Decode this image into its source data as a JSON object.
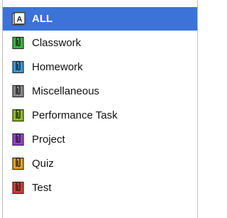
{
  "categories": [
    {
      "label": "ALL",
      "icon": "all-letter-a-icon",
      "color": "#ffffff",
      "selected": true
    },
    {
      "label": "Classwork",
      "icon": "green-clip-icon",
      "color": "#36b83a"
    },
    {
      "label": "Homework",
      "icon": "blue-clip-icon",
      "color": "#2f9be0"
    },
    {
      "label": "Miscellaneous",
      "icon": "gray-clip-icon",
      "color": "#8a8a8a"
    },
    {
      "label": "Performance Task",
      "icon": "lime-clip-icon",
      "color": "#8ec11c"
    },
    {
      "label": "Project",
      "icon": "purple-clip-icon",
      "color": "#9a3fd0"
    },
    {
      "label": "Quiz",
      "icon": "orange-clip-icon",
      "color": "#e6a21c"
    },
    {
      "label": "Test",
      "icon": "red-clip-icon",
      "color": "#d83a2f"
    }
  ],
  "all_icon_letter": "A"
}
